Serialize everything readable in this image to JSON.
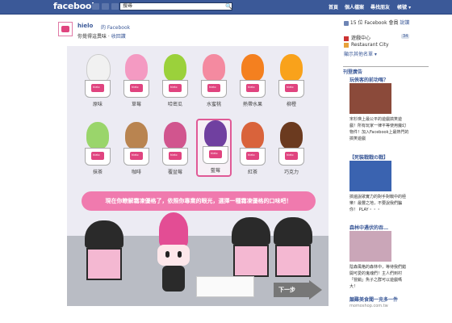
{
  "topbar": {
    "logo": "facebook",
    "search_value": "搜尋",
    "nav": [
      "首頁",
      "個人檔案",
      "尋找朋友",
      "帳號 ▾"
    ]
  },
  "post": {
    "page_name": "hielo",
    "page_type_suffix": "的 Facebook",
    "sub_prefix": "你覺得這異味 · ",
    "sub_link": "收回讚",
    "flavors": [
      "原味",
      "草莓",
      "哈密瓜",
      "水蜜桃",
      "熱帶水果",
      "柳橙",
      "抹茶",
      "咖啡",
      "覆盆莓",
      "藍莓",
      "紅茶",
      "巧克力"
    ],
    "badge_text": "hielo",
    "prompt": "現在你瞭解霜凍優格了，依照你專業的眼光，選擇一種霜凍優格的口味吧！",
    "next_label": "下一步",
    "colors": {
      "flavors": [
        "#f1f1f1",
        "#f49ac2",
        "#9bd13b",
        "#f48aa0",
        "#f4801f",
        "#f9a21b",
        "#9ad56b",
        "#b98450",
        "#d1558e",
        "#7040a0",
        "#d9633b",
        "#6b3a1f"
      ]
    }
  },
  "right": {
    "friends_line": "15 位 Facebook 會員",
    "friends_link": "說讚",
    "item1": "遊戲中心",
    "item1_count": "34",
    "item2": "Restaurant City",
    "more": "顯示其他名單 ▾",
    "sponsored": "刊登廣告",
    "ads": [
      {
        "title": "玩俠客的前功嗎？",
        "desc": "宋杉瑛上最公平的遊戲搞笑遊戲！所有玩家一律平等使用魔幻物件！加入Facebook上最熱門的搞笑遊戲"
      },
      {
        "title": "【死裝戰戰の戰】",
        "desc": "搞遍說歌實力的對手對戰中的極樂！最豐之地，不要說我們騙你！ PLAY・・・"
      },
      {
        "title": "森林中遇伏的吞…",
        "desc": "陰森風格的森林中，等待我們錯開可愛的鬼魂們！主人們到村「營銷」魚子之群可以遊戲嗎大！"
      },
      {
        "title": "顛難美食聞一充多一件",
        "desc": "momoshop.com.tw"
      }
    ]
  }
}
